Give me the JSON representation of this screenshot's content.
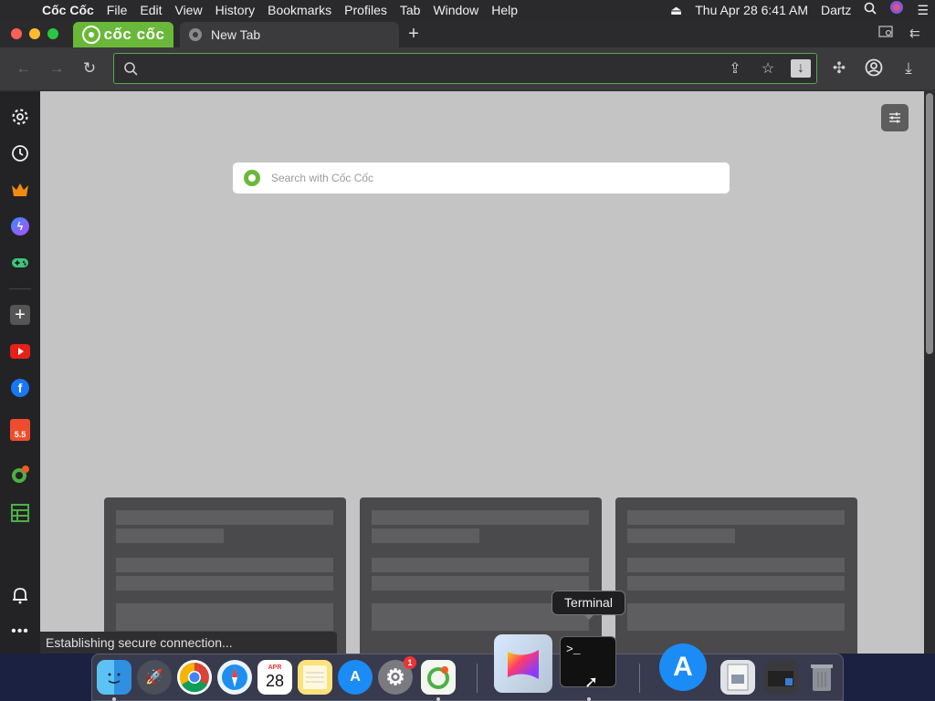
{
  "menubar": {
    "app_name": "Cốc Cốc",
    "items": [
      "File",
      "Edit",
      "View",
      "History",
      "Bookmarks",
      "Profiles",
      "Tab",
      "Window",
      "Help"
    ],
    "datetime": "Thu Apr 28  6:41 AM",
    "user": "Dartz"
  },
  "tabs": {
    "brand_label": "cốc cốc",
    "active_title": "New Tab",
    "new_tab_symbol": "+"
  },
  "omnibox": {
    "value": "",
    "placeholder": ""
  },
  "sidebar": {
    "items": [
      {
        "name": "settings",
        "icon": "gear-icon"
      },
      {
        "name": "history",
        "icon": "history-icon"
      },
      {
        "name": "shopping",
        "icon": "crown-icon"
      },
      {
        "name": "messenger",
        "icon": "messenger-icon"
      },
      {
        "name": "games",
        "icon": "gamepad-icon"
      },
      {
        "name": "add",
        "icon": "plus-icon"
      },
      {
        "name": "youtube",
        "icon": "youtube-icon"
      },
      {
        "name": "facebook",
        "icon": "facebook-icon"
      },
      {
        "name": "shopee",
        "icon": "shopping-bag-icon",
        "label": "5.5"
      },
      {
        "name": "coccoc-extension",
        "icon": "coccoc-icon"
      },
      {
        "name": "notes",
        "icon": "notes-icon"
      },
      {
        "name": "notifications",
        "icon": "bell-icon"
      },
      {
        "name": "more",
        "icon": "more-icon"
      }
    ]
  },
  "newtab": {
    "search_placeholder": "Search with Cốc Cốc"
  },
  "status_text": "Establishing secure connection...",
  "dock": {
    "tooltip": "Terminal",
    "calendar_month": "APR",
    "calendar_day": "28",
    "settings_badge": "1",
    "terminal_prompt": ">_"
  },
  "colors": {
    "brand_green": "#69b83a",
    "omnibox_border": "#57a84c",
    "page_background": "#c4c4c4"
  }
}
